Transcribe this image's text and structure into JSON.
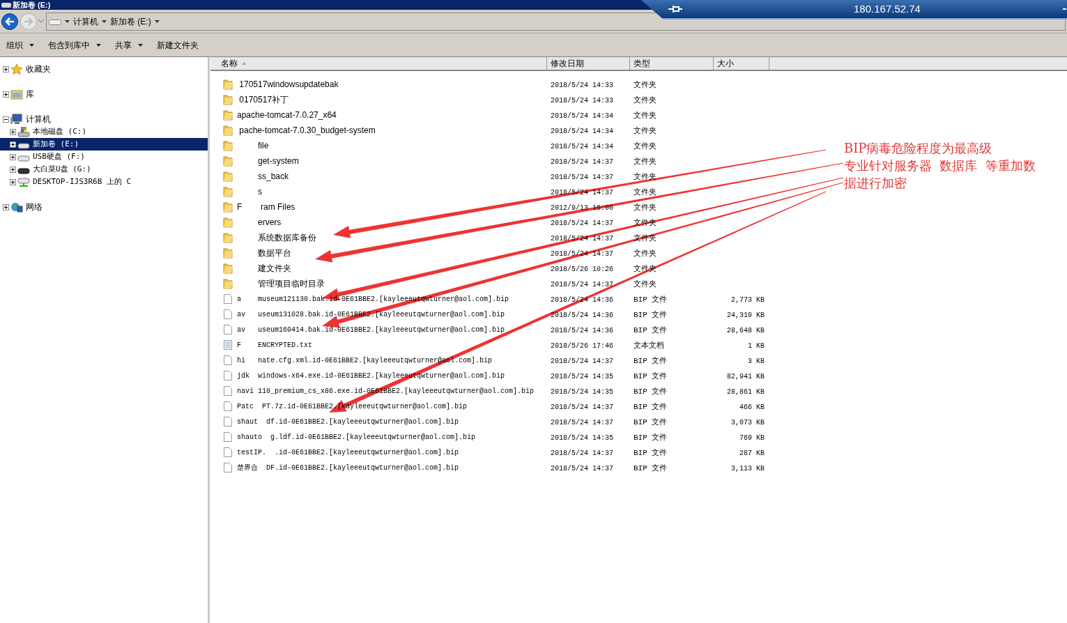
{
  "window": {
    "title": "新加卷 (E:)"
  },
  "remote_bar": {
    "host": "180.167.52.74"
  },
  "address": {
    "crumbs": [
      "计算机",
      "新加卷 (E:)"
    ]
  },
  "toolbar": [
    {
      "label": "组织",
      "dropdown": true
    },
    {
      "label": "包含到库中",
      "dropdown": true
    },
    {
      "label": "共享",
      "dropdown": true
    },
    {
      "label": "新建文件夹",
      "dropdown": false
    }
  ],
  "sidebar": {
    "groups": [
      {
        "label": "收藏夹",
        "kind": "favorites",
        "expanded": false,
        "selected": false
      },
      {
        "label": "库",
        "kind": "library",
        "expanded": false,
        "selected": false
      },
      {
        "label": "计算机",
        "kind": "computer",
        "expanded": true,
        "selected": false,
        "children": [
          {
            "label": "本地磁盘 (C:)",
            "kind": "system-drive",
            "selected": false
          },
          {
            "label": "新加卷 (E:)",
            "kind": "drive",
            "selected": true
          },
          {
            "label": "USB硬盘 (F:)",
            "kind": "drive",
            "selected": false
          },
          {
            "label": "大白菜U盘 (G:)",
            "kind": "usb",
            "selected": false
          },
          {
            "label": "DESKTOP-IJS3R6B 上的 C",
            "kind": "network-drive",
            "selected": false
          }
        ]
      },
      {
        "label": "网络",
        "kind": "network",
        "expanded": false,
        "selected": false
      }
    ]
  },
  "table": {
    "columns": [
      {
        "label": "名称",
        "sorted": true
      },
      {
        "label": "修改日期",
        "sorted": false
      },
      {
        "label": "类型",
        "sorted": false
      },
      {
        "label": "大小",
        "sorted": false
      }
    ],
    "rows": [
      {
        "kind": "folder",
        "name": " 170517windowsupdatebak",
        "modified": "2018/5/24 14:33",
        "type": "文件夹"
      },
      {
        "kind": "folder",
        "name": " 0170517补丁",
        "modified": "2018/5/24 14:33",
        "type": "文件夹"
      },
      {
        "kind": "folder",
        "name": "apache-tomcat-7.0.27_x64",
        "modified": "2018/5/24 14:34",
        "type": "文件夹"
      },
      {
        "kind": "folder",
        "name": " pache-tomcat-7.0.30_budget-system",
        "modified": "2018/5/24 14:34",
        "type": "文件夹"
      },
      {
        "kind": "folder",
        "name": "         file",
        "modified": "2018/5/24 14:34",
        "type": "文件夹"
      },
      {
        "kind": "folder",
        "name": "         get-system",
        "modified": "2018/5/24 14:37",
        "type": "文件夹"
      },
      {
        "kind": "folder",
        "name": "         ss_back",
        "modified": "2018/5/24 14:37",
        "type": "文件夹"
      },
      {
        "kind": "folder",
        "name": "         s",
        "modified": "2018/5/24 14:37",
        "type": "文件夹"
      },
      {
        "kind": "folder",
        "name": "F        ram Files",
        "modified": "2012/9/13 16:00",
        "type": "文件夹"
      },
      {
        "kind": "folder",
        "name": "         ervers",
        "modified": "2018/5/24 14:37",
        "type": "文件夹"
      },
      {
        "kind": "folder",
        "name": "         系统数据库备份",
        "modified": "2018/5/24 14:37",
        "type": "文件夹"
      },
      {
        "kind": "folder",
        "name": "         数据平台",
        "modified": "2018/5/24 14:37",
        "type": "文件夹"
      },
      {
        "kind": "folder",
        "name": "         建文件夹",
        "modified": "2018/5/26 10:26",
        "type": "文件夹"
      },
      {
        "kind": "folder",
        "name": "         管理项目临时目录",
        "modified": "2018/5/24 14:37",
        "type": "文件夹"
      },
      {
        "kind": "file",
        "name": "a    museum121130.bak.id-0E61BBE2.[kayleeeutqwturner@aol.com].bip",
        "modified": "2018/5/24 14:36",
        "type": "BIP 文件",
        "size": "2,773 KB"
      },
      {
        "kind": "file",
        "name": "av   useum131028.bak.id-0E61BBE2.[kayleeeutqwturner@aol.com].bip",
        "modified": "2018/5/24 14:36",
        "type": "BIP 文件",
        "size": "24,310 KB"
      },
      {
        "kind": "file",
        "name": "av   useum160414.bak.id-0E61BBE2.[kayleeeutqwturner@aol.com].bip",
        "modified": "2018/5/24 14:36",
        "type": "BIP 文件",
        "size": "28,648 KB"
      },
      {
        "kind": "text",
        "name": "F    ENCRYPTED.txt",
        "modified": "2018/5/26 17:46",
        "type": "文本文档",
        "size": "1 KB"
      },
      {
        "kind": "file",
        "name": "hi   nate.cfg.xml.id-0E61BBE2.[kayleeeutqwturner@aol.com].bip",
        "modified": "2018/5/24 14:37",
        "type": "BIP 文件",
        "size": "3 KB"
      },
      {
        "kind": "file",
        "name": "jdk  windows-x64.exe.id-0E61BBE2.[kayleeeutqwturner@aol.com].bip",
        "modified": "2018/5/24 14:35",
        "type": "BIP 文件",
        "size": "82,941 KB"
      },
      {
        "kind": "file",
        "name": "navi 110_premium_cs_x86.exe.id-0E61BBE2.[kayleeeutqwturner@aol.com].bip",
        "modified": "2018/5/24 14:35",
        "type": "BIP 文件",
        "size": "28,861 KB"
      },
      {
        "kind": "file",
        "name": "Patc  PT.7z.id-0E61BBE2.[kayleeeutqwturner@aol.com].bip",
        "modified": "2018/5/24 14:37",
        "type": "BIP 文件",
        "size": "466 KB"
      },
      {
        "kind": "file",
        "name": "shaut  df.id-0E61BBE2.[kayleeeutqwturner@aol.com].bip",
        "modified": "2018/5/24 14:37",
        "type": "BIP 文件",
        "size": "3,073 KB"
      },
      {
        "kind": "file",
        "name": "shauto  g.ldf.id-0E61BBE2.[kayleeeutqwturner@aol.com].bip",
        "modified": "2018/5/24 14:35",
        "type": "BIP 文件",
        "size": "769 KB"
      },
      {
        "kind": "file",
        "name": "testIP.  .id-0E61BBE2.[kayleeeutqwturner@aol.com].bip",
        "modified": "2018/5/24 14:37",
        "type": "BIP 文件",
        "size": "287 KB"
      },
      {
        "kind": "file",
        "name": "楚界合  DF.id-0E61BBE2.[kayleeeutqwturner@aol.com].bip",
        "modified": "2018/5/24 14:37",
        "type": "BIP 文件",
        "size": "3,113 KB"
      }
    ]
  },
  "annotation": {
    "lines": [
      "BIP病毒危险程度为最高级",
      "专业针对服务器  数据库  等重加数",
      "据进行加密"
    ]
  }
}
